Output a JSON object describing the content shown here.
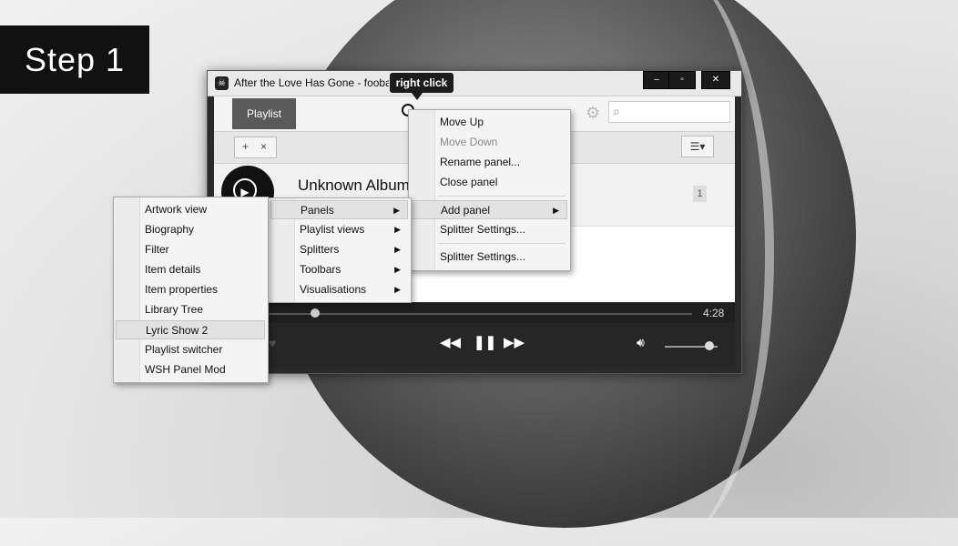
{
  "step_label": "Step 1",
  "window": {
    "title": "After the Love Has Gone - foobar2000",
    "min_icon": "minimize-icon",
    "max_icon": "maximize-icon",
    "close_icon": "close-icon"
  },
  "tooltip": {
    "text": "right click"
  },
  "toolbar": {
    "tab_label": "Playlist",
    "search_placeholder": ""
  },
  "playlist": {
    "add_button": "+",
    "remove_button": "×",
    "album_title": "Unknown Album",
    "track_number": "1"
  },
  "player": {
    "time": "4:28",
    "seek_fraction": 0.11,
    "volume_fraction": 0.85
  },
  "context_menu": {
    "items": [
      {
        "label": "Move Up",
        "disabled": false
      },
      {
        "label": "Move Down",
        "disabled": true
      },
      {
        "label": "Rename panel...",
        "disabled": false
      },
      {
        "label": "Close panel",
        "disabled": false
      },
      {
        "label": "Add panel",
        "disabled": false,
        "submenu": true,
        "highlighted": true
      },
      {
        "label": "Splitter Settings...",
        "disabled": false
      },
      {
        "label": "Splitter Settings...",
        "disabled": false
      }
    ]
  },
  "add_panel_menu": {
    "items": [
      "Panels",
      "Playlist views",
      "Splitters",
      "Toolbars",
      "Visualisations"
    ]
  },
  "panels_menu": {
    "items": [
      "Artwork view",
      "Biography",
      "Filter",
      "Item details",
      "Item properties",
      "Library Tree",
      "Lyric Show 2",
      "Playlist switcher",
      "WSH Panel Mod"
    ],
    "highlighted": "Lyric Show 2"
  },
  "colors": {
    "accent": "#5a5a5a",
    "player_bg": "#262626"
  }
}
